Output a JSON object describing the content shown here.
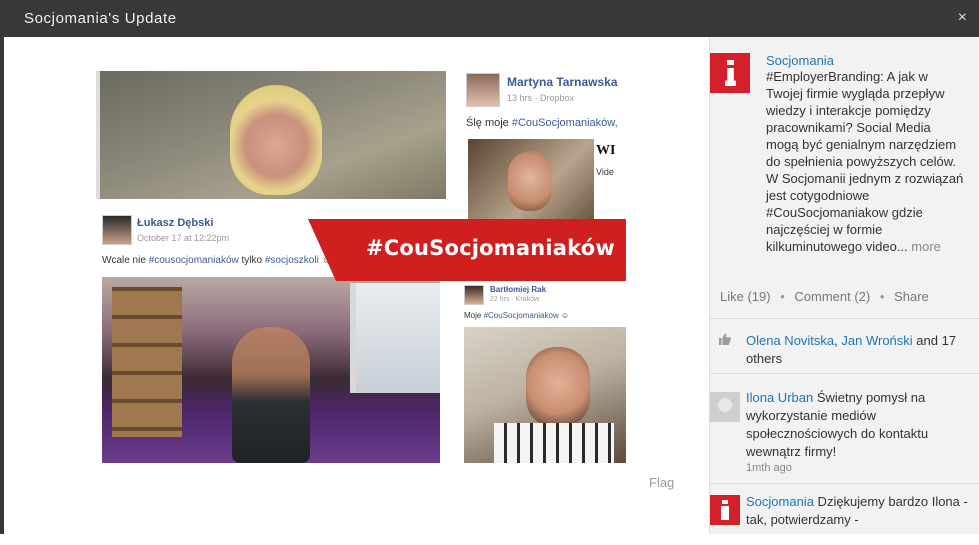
{
  "modal": {
    "title": "Socjomania's Update",
    "close_label": "×"
  },
  "media": {
    "card_martyna": {
      "name": "Martyna Tarnawska",
      "meta": "13 hrs · Dropbox",
      "text_prefix": "Ślę moje ",
      "hashtag": "#CouSocjomaniaków,",
      "video_title": "WI",
      "video_sub": "Vide"
    },
    "card_lukasz": {
      "name": "Łukasz Dębski",
      "meta": "October 17 at 12:22pm",
      "text_prefix": "Wcale nie ",
      "hashtag1": "#cousocjomaniaków",
      "text_mid": " tylko ",
      "hashtag2": "#socjoszkoli",
      "emoji": " ☺"
    },
    "card_bart": {
      "name": "Bartłomiej Rak",
      "meta": "22 hrs · Kraków",
      "text_prefix": "Moje ",
      "hashtag": "#CouSocjomaniakow",
      "emoji": " ☺"
    },
    "banner_text": "#CouSocjomaniaków",
    "flag_label": "Flag"
  },
  "post": {
    "author": "Socjomania",
    "body": "#EmployerBranding: A jak w Twojej firmie wygląda przepływ wiedzy i interakcje pomiędzy pracownikami? Social Media mogą być genialnym narzędziem do spełnienia powyższych celów. W Socjomanii jednym z rozwiązań jest cotygodniowe #CouSocjomaniakow gdzie najczęściej w formie kilkuminutowego video...",
    "more_label": "more",
    "like_label": "Like (19)",
    "comment_label": "Comment (2)",
    "share_label": "Share",
    "separator": "•"
  },
  "likes": {
    "name1": "Olena Novitska",
    "sep": ", ",
    "name2": "Jan Wroński",
    "rest": " and 17 others"
  },
  "comments": [
    {
      "author": "Ilona Urban",
      "text": " Świetny pomysł na wykorzystanie mediów społecznościowych do kontaktu wewnątrz firmy!",
      "time": "1mth ago"
    },
    {
      "author": "Socjomania",
      "text": " Dziękujemy bardzo Ilona - tak, potwierdzamy -"
    }
  ],
  "colors": {
    "header_bg": "#383838",
    "brand_red": "#d4202b",
    "banner_red": "#cf1f1f",
    "link_blue": "#1b75bb",
    "fb_blue": "#3b5998"
  }
}
